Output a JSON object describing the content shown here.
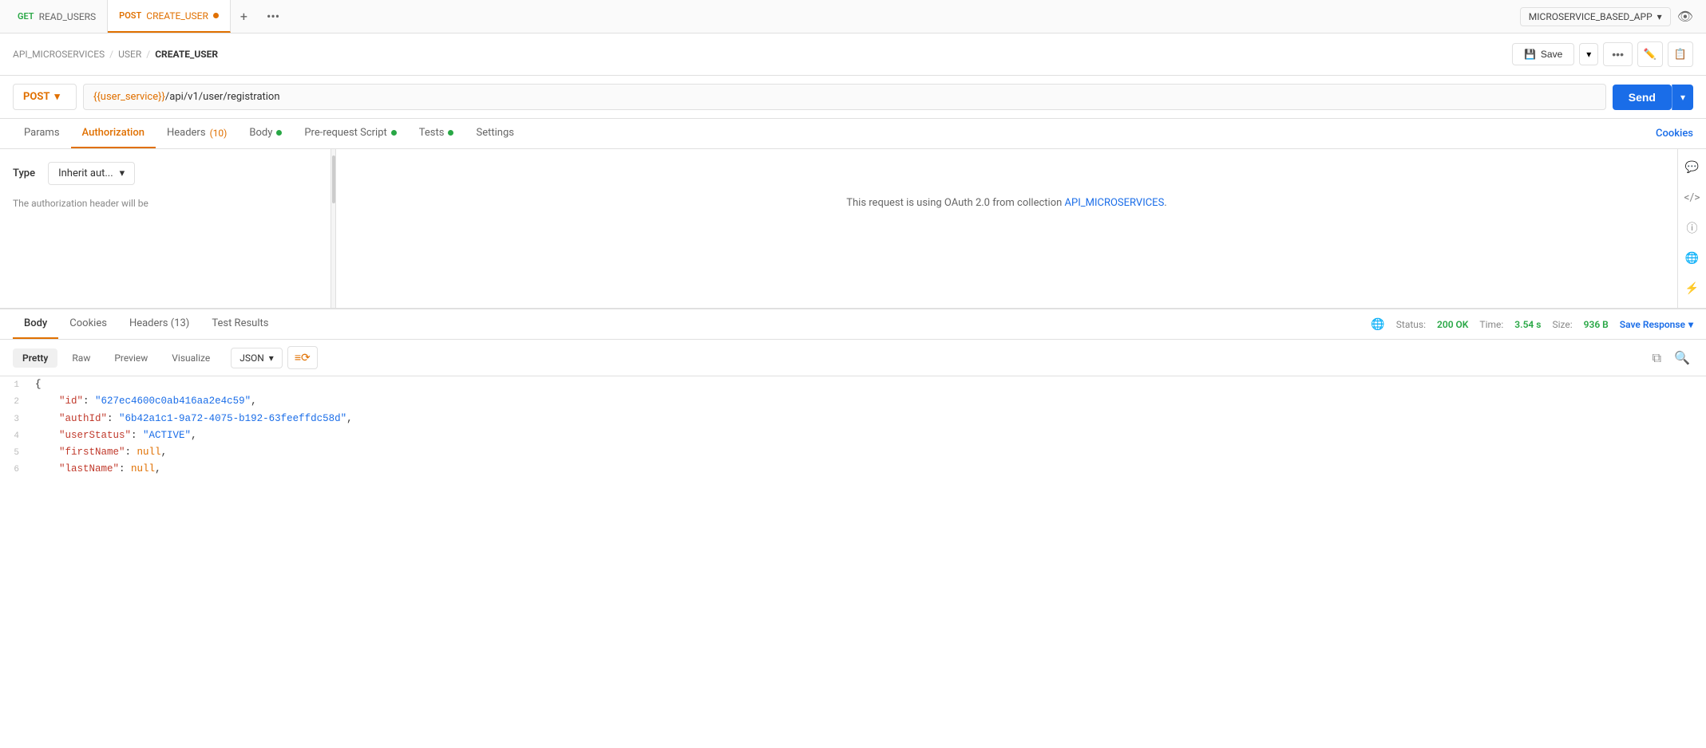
{
  "tabs": [
    {
      "id": "get-read-users",
      "method": "GET",
      "name": "READ_USERS",
      "active": false
    },
    {
      "id": "post-create-user",
      "method": "POST",
      "name": "CREATE_USER",
      "active": true,
      "dot": true
    }
  ],
  "tab_plus": "+",
  "tab_more": "•••",
  "env_selector": {
    "label": "MICROSERVICE_BASED_APP",
    "chevron": "▾"
  },
  "breadcrumb": {
    "items": [
      "API_MICROSERVICES",
      "USER",
      "CREATE_USER"
    ],
    "separators": [
      "/",
      "/"
    ]
  },
  "toolbar": {
    "save_label": "Save",
    "more_label": "•••"
  },
  "request": {
    "method": "POST",
    "url_prefix": "{{user_service}}",
    "url_suffix": "/api/v1/user/registration",
    "send_label": "Send"
  },
  "request_tabs": [
    {
      "id": "params",
      "label": "Params",
      "active": false
    },
    {
      "id": "authorization",
      "label": "Authorization",
      "active": true
    },
    {
      "id": "headers",
      "label": "Headers",
      "count": "(10)",
      "active": false
    },
    {
      "id": "body",
      "label": "Body",
      "dot": true,
      "active": false
    },
    {
      "id": "pre-request",
      "label": "Pre-request Script",
      "dot": true,
      "active": false
    },
    {
      "id": "tests",
      "label": "Tests",
      "dot": true,
      "active": false
    },
    {
      "id": "settings",
      "label": "Settings",
      "active": false
    }
  ],
  "cookies_link": "Cookies",
  "authorization": {
    "type_label": "Type",
    "type_value": "Inherit aut...",
    "info_text": "The authorization header will be",
    "oauth_message": "This request is using OAuth 2.0 from collection",
    "collection_link": "API_MICROSERVICES",
    "period": "."
  },
  "response": {
    "tabs": [
      {
        "id": "body",
        "label": "Body",
        "active": true
      },
      {
        "id": "cookies",
        "label": "Cookies",
        "active": false
      },
      {
        "id": "headers",
        "label": "Headers (13)",
        "active": false
      },
      {
        "id": "test-results",
        "label": "Test Results",
        "active": false
      }
    ],
    "status_label": "Status:",
    "status_value": "200 OK",
    "time_label": "Time:",
    "time_value": "3.54 s",
    "size_label": "Size:",
    "size_value": "936 B",
    "save_response": "Save Response"
  },
  "format_tabs": [
    {
      "id": "pretty",
      "label": "Pretty",
      "active": true
    },
    {
      "id": "raw",
      "label": "Raw",
      "active": false
    },
    {
      "id": "preview",
      "label": "Preview",
      "active": false
    },
    {
      "id": "visualize",
      "label": "Visualize",
      "active": false
    }
  ],
  "format_dropdown": {
    "value": "JSON",
    "chevron": "▾"
  },
  "json_lines": [
    {
      "num": 1,
      "content": "{",
      "type": "brace"
    },
    {
      "num": 2,
      "key": "id",
      "value": "\"627ec4600c0ab416aa2e4c59\"",
      "value_type": "string"
    },
    {
      "num": 3,
      "key": "authId",
      "value": "\"6b42a1c1-9a72-4075-b192-63feeffdc58d\"",
      "value_type": "string"
    },
    {
      "num": 4,
      "key": "userStatus",
      "value": "\"ACTIVE\"",
      "value_type": "string"
    },
    {
      "num": 5,
      "key": "firstName",
      "value": "null",
      "value_type": "null"
    },
    {
      "num": 6,
      "key": "lastName",
      "value": "null",
      "value_type": "null"
    }
  ]
}
